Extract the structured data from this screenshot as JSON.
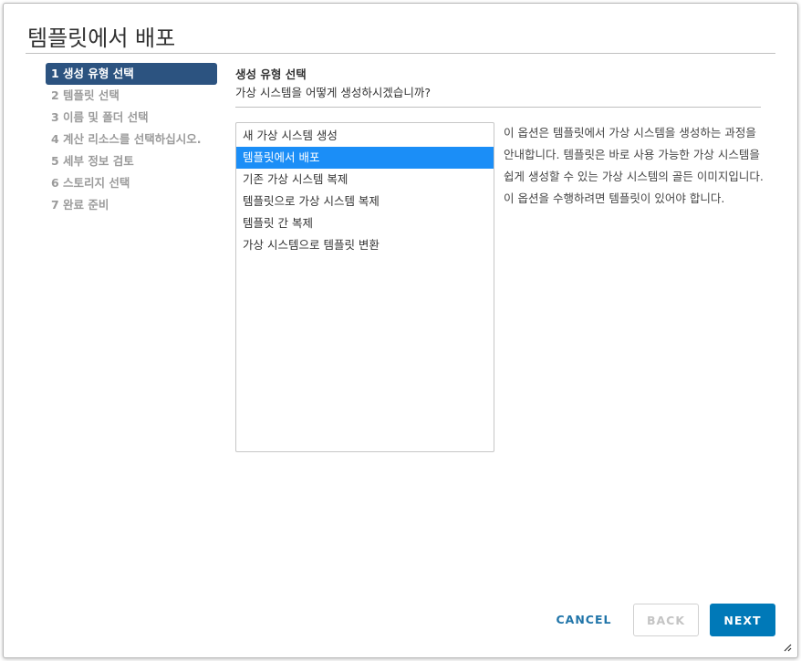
{
  "dialog": {
    "title": "템플릿에서 배포"
  },
  "steps": [
    {
      "label": "1 생성 유형 선택",
      "active": true
    },
    {
      "label": "2 템플릿 선택",
      "active": false
    },
    {
      "label": "3 이름 및 폴더 선택",
      "active": false
    },
    {
      "label": "4 계산 리소스를 선택하십시오.",
      "active": false
    },
    {
      "label": "5 세부 정보 검토",
      "active": false
    },
    {
      "label": "6 스토리지 선택",
      "active": false
    },
    {
      "label": "7 완료 준비",
      "active": false
    }
  ],
  "content": {
    "title": "생성 유형 선택",
    "subtitle": "가상 시스템을 어떻게 생성하시겠습니까?",
    "options": [
      {
        "label": "새 가상 시스템 생성",
        "selected": false
      },
      {
        "label": "템플릿에서 배포",
        "selected": true
      },
      {
        "label": "기존 가상 시스템 복제",
        "selected": false
      },
      {
        "label": "템플릿으로 가상 시스템 복제",
        "selected": false
      },
      {
        "label": "템플릿 간 복제",
        "selected": false
      },
      {
        "label": "가상 시스템으로 템플릿 변환",
        "selected": false
      }
    ],
    "description": "이 옵션은 템플릿에서 가상 시스템을 생성하는 과정을 안내합니다. 템플릿은 바로 사용 가능한 가상 시스템을 쉽게 생성할 수 있는 가상 시스템의 골든 이미지입니다. 이 옵션을 수행하려면 템플릿이 있어야 합니다."
  },
  "footer": {
    "cancel_label": "CANCEL",
    "back_label": "BACK",
    "next_label": "NEXT"
  },
  "colors": {
    "active_step_bg": "#2c5380",
    "selected_option_bg": "#1b8ef7",
    "primary_button": "#0079b8",
    "link_text": "#2175a9"
  }
}
